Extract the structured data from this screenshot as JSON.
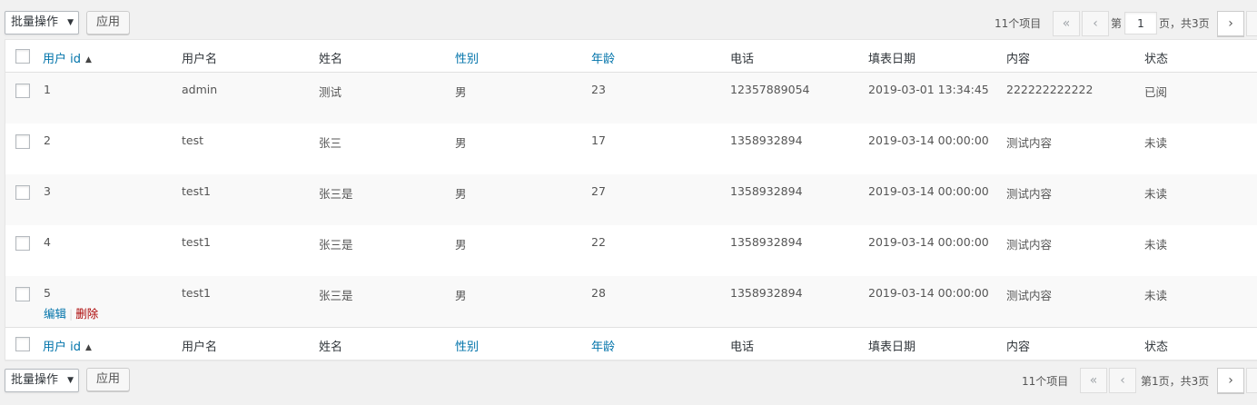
{
  "nav_top": {
    "bulk_label": "批量操作",
    "apply_label": "应用",
    "count": "11个项目",
    "first_label": "«",
    "prev_label": "‹",
    "page_prefix": "第",
    "page_value": "1",
    "page_suffix": "页，共3页",
    "next_label": "›"
  },
  "nav_bottom": {
    "bulk_label": "批量操作",
    "apply_label": "应用",
    "count": "11个项目",
    "first_label": "«",
    "prev_label": "‹",
    "page_text": "第1页，共3页",
    "next_label": "›"
  },
  "columns": [
    {
      "label": "用户 id",
      "sortable": true
    },
    {
      "label": "用户名",
      "sortable": false
    },
    {
      "label": "姓名",
      "sortable": false
    },
    {
      "label": "性别",
      "sortable": true
    },
    {
      "label": "年龄",
      "sortable": true
    },
    {
      "label": "电话",
      "sortable": false
    },
    {
      "label": "填表日期",
      "sortable": false
    },
    {
      "label": "内容",
      "sortable": false
    },
    {
      "label": "状态",
      "sortable": false
    }
  ],
  "sort_indicator": "▲",
  "rows": [
    [
      "1",
      "admin",
      "测试",
      "男",
      "23",
      "12357889054",
      "2019-03-01 13:34:45",
      "222222222222",
      "已阅"
    ],
    [
      "2",
      "test",
      "张三",
      "男",
      "17",
      "1358932894",
      "2019-03-14 00:00:00",
      "测试内容",
      "未读"
    ],
    [
      "3",
      "test1",
      "张三是",
      "男",
      "27",
      "1358932894",
      "2019-03-14 00:00:00",
      "测试内容",
      "未读"
    ],
    [
      "4",
      "test1",
      "张三是",
      "男",
      "22",
      "1358932894",
      "2019-03-14 00:00:00",
      "测试内容",
      "未读"
    ],
    [
      "5",
      "test1",
      "张三是",
      "男",
      "28",
      "1358932894",
      "2019-03-14 00:00:00",
      "测试内容",
      "未读"
    ]
  ],
  "row_actions": {
    "edit": "编辑",
    "sep": "|",
    "delete": "删除"
  },
  "colors": {
    "link": "#0073aa",
    "delete": "#aa0000",
    "stripe": "#f9f9f9"
  }
}
